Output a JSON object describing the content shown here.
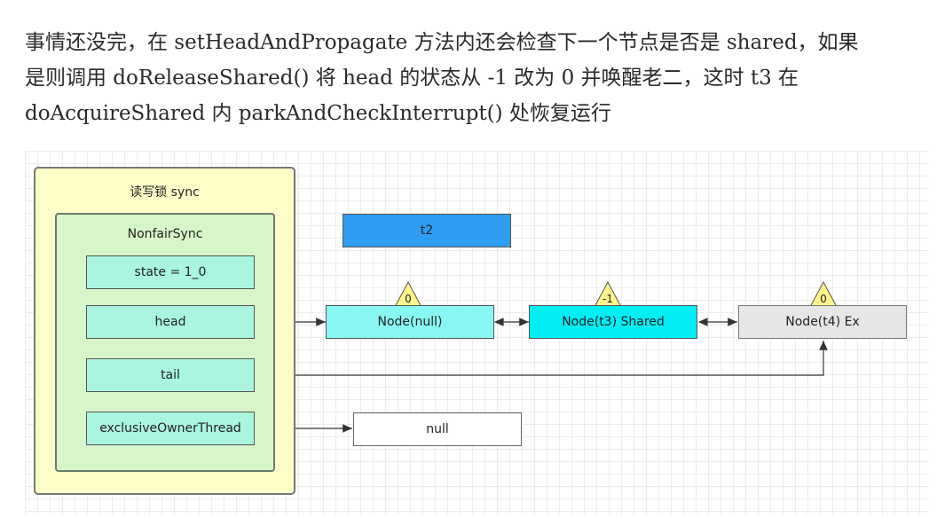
{
  "paragraph": {
    "line1": "事情还没完，在 setHeadAndPropagate 方法内还会检查下一个节点是否是 shared，如果",
    "line2": "是则调用 doReleaseShared() 将 head 的状态从 -1 改为 0 并唤醒老二，这时 t3 在",
    "line3": "doAcquireShared 内 parkAndCheckInterrupt() 处恢复运行"
  },
  "diagram": {
    "outer_title": "读写锁 sync",
    "inner_title": "NonfairSync",
    "fields": {
      "state": "state = 1_0",
      "head": "head",
      "tail": "tail",
      "owner": "exclusiveOwnerThread"
    },
    "thread_box": "t2",
    "nodes": {
      "null_node": "Node(null)",
      "t3_node": "Node(t3) Shared",
      "t4_node": "Node(t4) Ex"
    },
    "null_target": "null",
    "waitstatus": {
      "null_node": "0",
      "t3_node": "-1",
      "t4_node": "0"
    },
    "colors": {
      "outer_fill": "#fdfdc8",
      "inner_fill": "#d7f5c8",
      "field_fill": "#a9f5e0",
      "t2_fill": "#2e9df2",
      "t3_fill": "#00eef4",
      "t4_fill": "#e6e6e6",
      "badge_fill": "#fff48a"
    }
  }
}
